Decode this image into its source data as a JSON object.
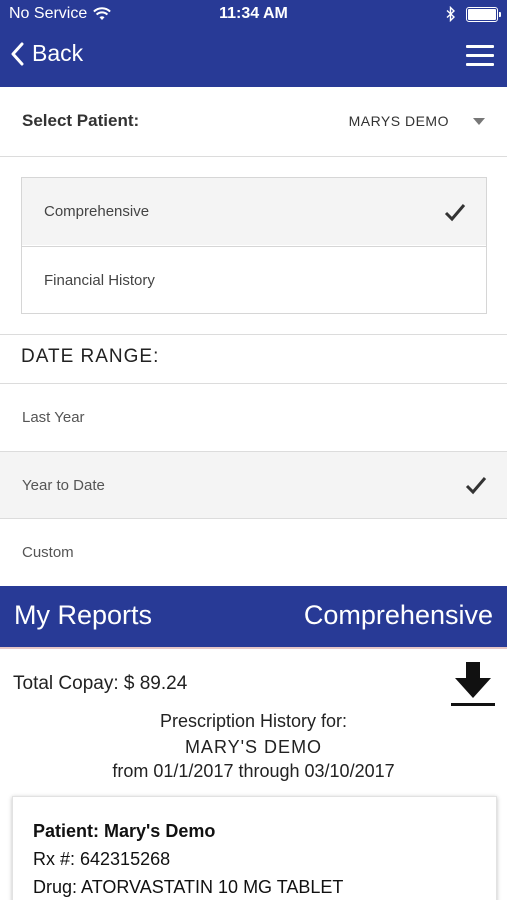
{
  "status_bar": {
    "carrier": "No Service",
    "time": "11:34 AM"
  },
  "nav": {
    "back_label": "Back"
  },
  "patient": {
    "label": "Select Patient:",
    "selected": "MARYS DEMO"
  },
  "report_types": [
    {
      "label": "Comprehensive",
      "selected": true
    },
    {
      "label": "Financial History",
      "selected": false
    }
  ],
  "date_range": {
    "title": "DATE RANGE:",
    "options": [
      {
        "label": "Last Year",
        "selected": false
      },
      {
        "label": "Year to Date",
        "selected": true
      },
      {
        "label": "Custom",
        "selected": false
      }
    ]
  },
  "reports_bar": {
    "title": "My Reports",
    "type": "Comprehensive"
  },
  "summary": {
    "total_copay": "Total Copay: $ 89.24",
    "history_for": "Prescription History for:",
    "patient_name": "MARY'S DEMO",
    "period": "from 01/1/2017 through 03/10/2017"
  },
  "prescription_card": {
    "patient": "Patient: Mary's Demo",
    "rx_number": "Rx #: 642315268",
    "drug": "Drug: ATORVASTATIN 10 MG TABLET"
  },
  "colors": {
    "brand_blue": "#283a96",
    "selected_bg": "#f4f4f4",
    "divider": "#dcdcdc"
  },
  "icons": [
    "wifi-icon",
    "bluetooth-icon",
    "battery-icon",
    "back-chevron-icon",
    "hamburger-menu-icon",
    "dropdown-caret-icon",
    "checkmark-icon",
    "download-icon"
  ]
}
